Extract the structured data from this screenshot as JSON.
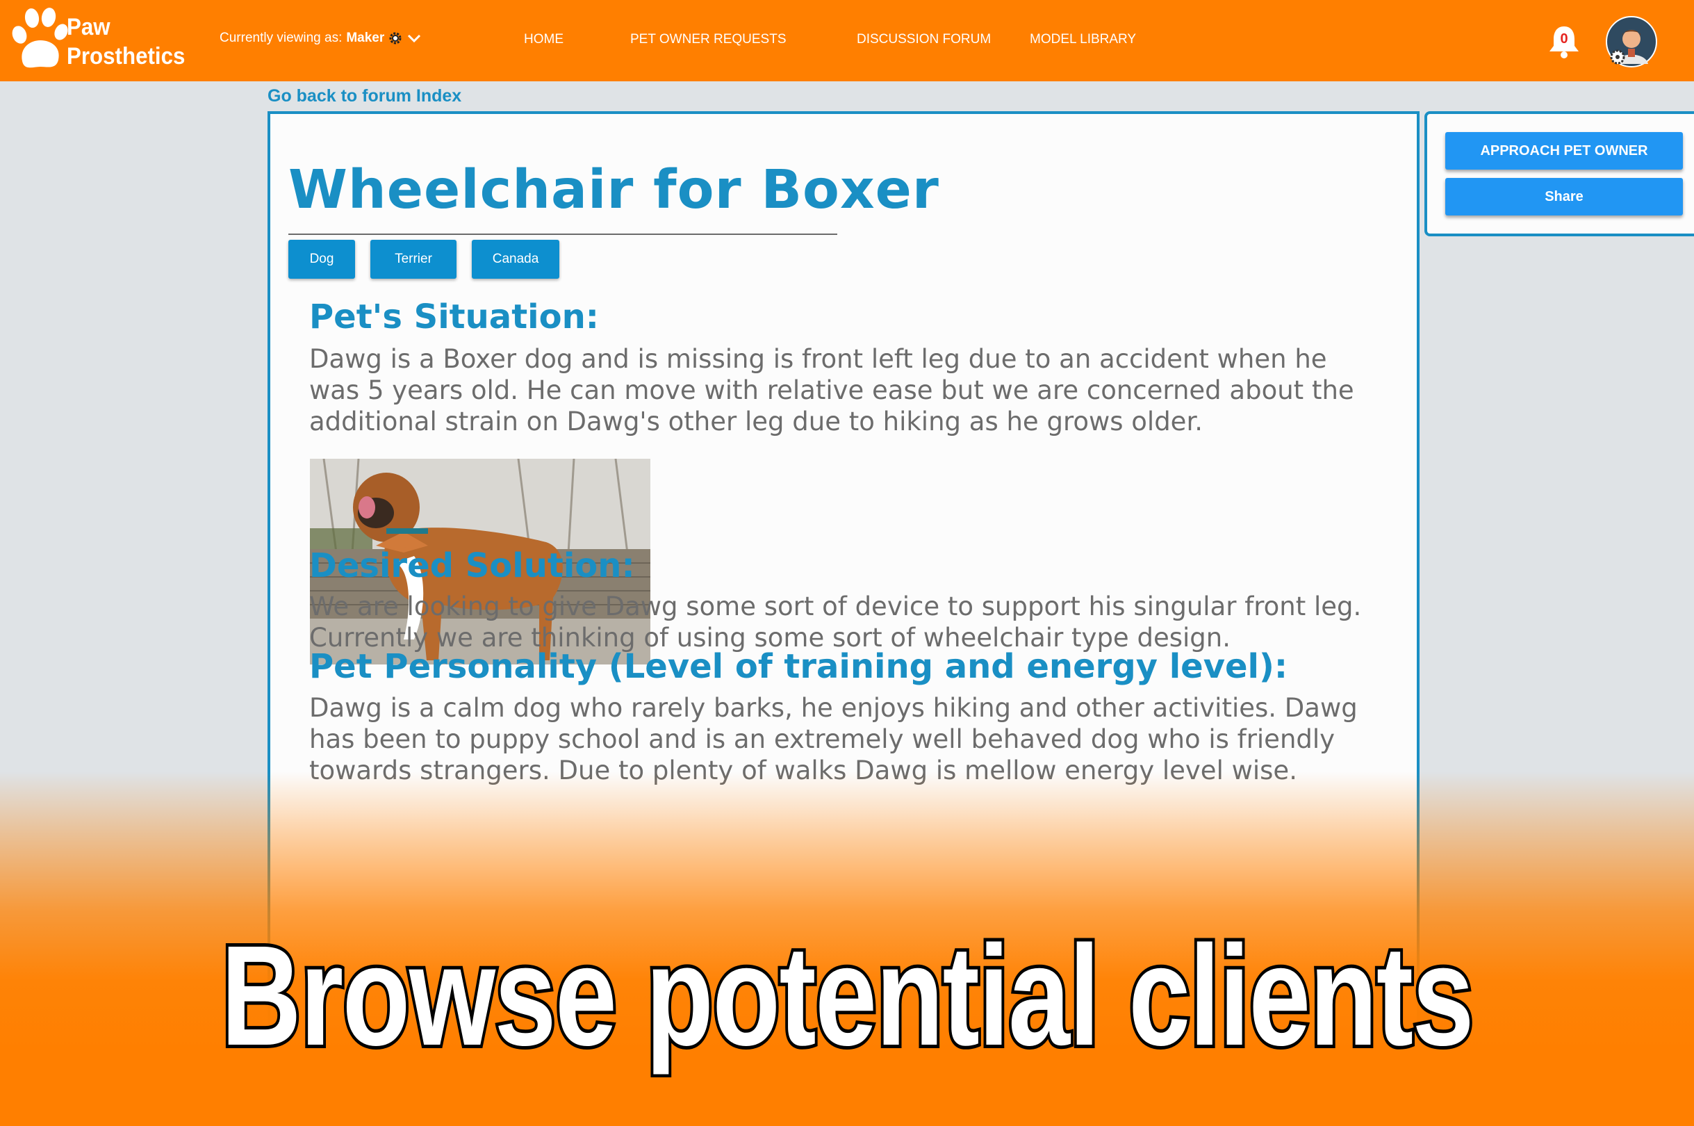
{
  "header": {
    "logo_line1": "Paw",
    "logo_line2": "Prosthetics",
    "viewing_prefix": "Currently viewing as:",
    "viewing_role": "Maker",
    "nav": [
      {
        "label": "HOME"
      },
      {
        "label": "PET OWNER REQUESTS"
      },
      {
        "label": "DISCUSSION FORUM"
      },
      {
        "label": "MODEL LIBRARY"
      }
    ],
    "notification_count": "0"
  },
  "main": {
    "back_link": "Go back to forum Index",
    "title": "Wheelchair for Boxer",
    "tags": [
      "Dog",
      "Terrier",
      "Canada"
    ],
    "sections": [
      {
        "heading": "Pet's Situation:",
        "body": "Dawg is a Boxer dog and is missing is front left leg due to an accident when he was 5 years old. He can move with relative ease but we are concerned about the additional strain on Dawg's other leg due to hiking as he grows older."
      },
      {
        "heading": "Desired Solution:",
        "body": "We are looking to give Dawg some sort of device to support his singular front leg. Currently we are thinking of using some sort of wheelchair type design."
      },
      {
        "heading": "Pet Personality (Level of training and energy level):",
        "body": "Dawg is a calm dog who rarely barks, he enjoys hiking and other activities. Dawg  has been to puppy school and is an extremely well behaved dog who is friendly towards strangers. Due to plenty of walks Dawg is mellow energy level wise."
      }
    ]
  },
  "side": {
    "approach_label": "APPROACH PET OWNER",
    "share_label": "Share"
  },
  "caption": "Browse potential clients",
  "colors": {
    "brand_orange": "#ff7f00",
    "accent_blue": "#1a8fc4",
    "button_blue": "#2196f3",
    "badge_red": "#e52420"
  }
}
